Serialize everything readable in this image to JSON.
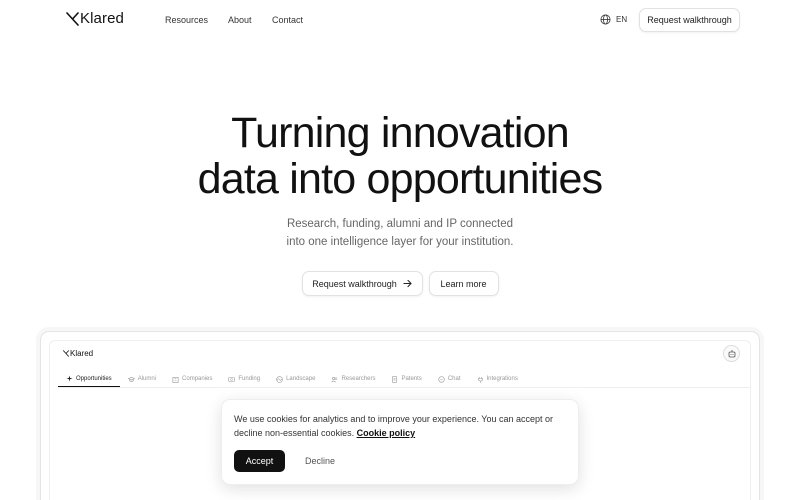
{
  "nav": {
    "brand": "Klared",
    "links": [
      {
        "label": "Resources"
      },
      {
        "label": "About"
      },
      {
        "label": "Contact"
      }
    ],
    "language": "EN",
    "cta_label": "Request walkthrough"
  },
  "hero": {
    "title_line1": "Turning innovation",
    "title_line2": "data into opportunities",
    "subtitle_line1": "Research, funding, alumni and IP connected",
    "subtitle_line2": "into one intelligence layer for your institution.",
    "primary_button": "Request walkthrough",
    "secondary_button": "Learn more"
  },
  "app_preview": {
    "brand": "Klared",
    "tabs": [
      {
        "label": "Opportunities",
        "icon": "sparkle-icon",
        "active": true
      },
      {
        "label": "Alumni",
        "icon": "graduation-cap-icon",
        "active": false
      },
      {
        "label": "Companies",
        "icon": "building-icon",
        "active": false
      },
      {
        "label": "Funding",
        "icon": "money-icon",
        "active": false
      },
      {
        "label": "Landscape",
        "icon": "landscape-icon",
        "active": false
      },
      {
        "label": "Researchers",
        "icon": "researchers-icon",
        "active": false
      },
      {
        "label": "Patents",
        "icon": "document-icon",
        "active": false
      },
      {
        "label": "Chat",
        "icon": "chat-icon",
        "active": false
      },
      {
        "label": "Integrations",
        "icon": "plug-icon",
        "active": false
      }
    ]
  },
  "cookie": {
    "text": "We use cookies for analytics and to improve your experience. You can accept or decline non-essential cookies.",
    "link_label": "Cookie policy",
    "accept_label": "Accept",
    "decline_label": "Decline"
  }
}
